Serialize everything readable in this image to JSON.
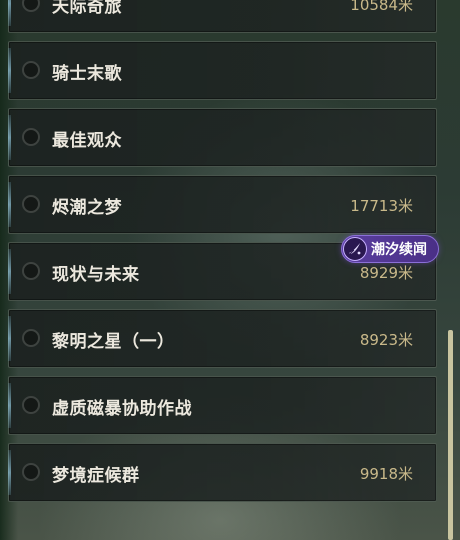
{
  "quests": [
    {
      "title": "天际奇旅",
      "distance": "10584米"
    },
    {
      "title": "骑士末歌",
      "distance": ""
    },
    {
      "title": "最佳观众",
      "distance": ""
    },
    {
      "title": "烬潮之梦",
      "distance": "17713米"
    },
    {
      "title": "现状与未来",
      "distance": "8929米"
    },
    {
      "title": "黎明之星（一）",
      "distance": "8923米"
    },
    {
      "title": "虚质磁暴协助作战",
      "distance": ""
    },
    {
      "title": "梦境症候群",
      "distance": "9918米"
    }
  ],
  "badge": {
    "label": "潮汐续闻",
    "icon": "tidal-feather-icon"
  },
  "colors": {
    "distance": "#c9b98a",
    "title": "#ece8de",
    "badge": "#5a3ea0"
  }
}
